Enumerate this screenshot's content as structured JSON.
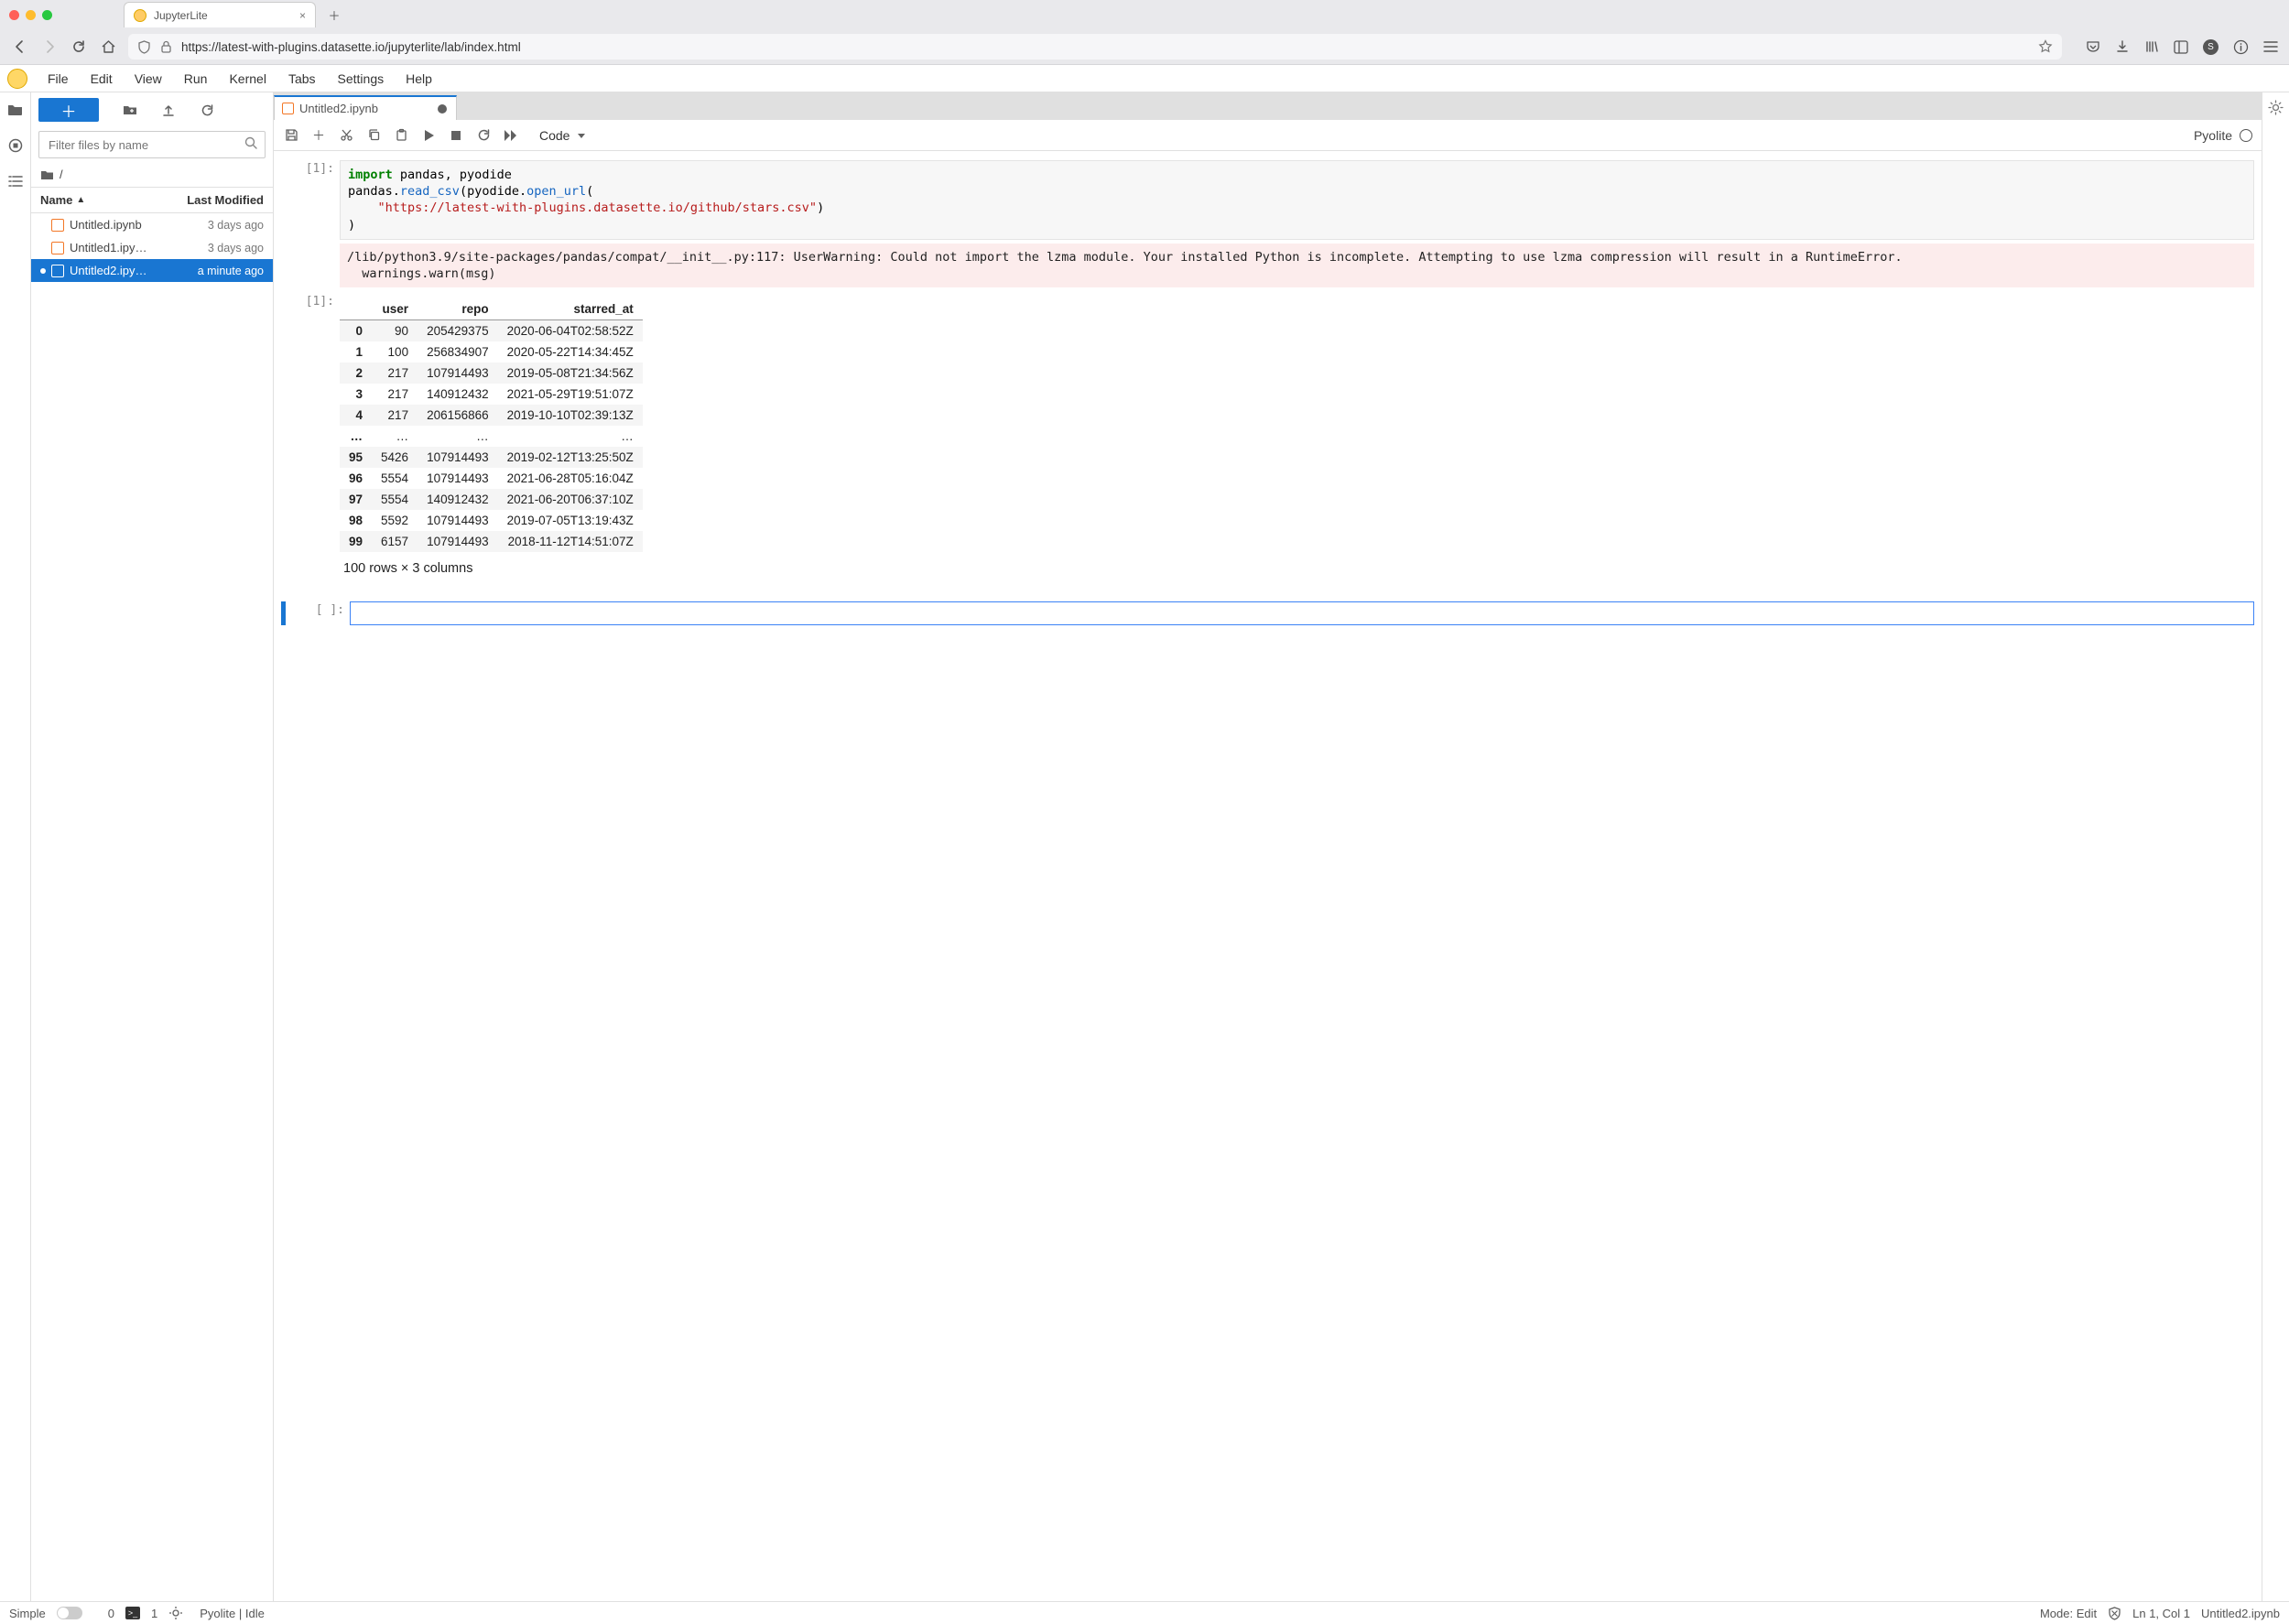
{
  "browser": {
    "tab_title": "JupyterLite",
    "url": "https://latest-with-plugins.datasette.io/jupyterlite/lab/index.html"
  },
  "menu": [
    "File",
    "Edit",
    "View",
    "Run",
    "Kernel",
    "Tabs",
    "Settings",
    "Help"
  ],
  "filebrowser": {
    "filter_placeholder": "Filter files by name",
    "crumb_root": "/",
    "head_name": "Name",
    "head_modified": "Last Modified",
    "files": [
      {
        "name": "Untitled.ipynb",
        "modified": "3 days ago",
        "dirty": false,
        "selected": false
      },
      {
        "name": "Untitled1.ipy…",
        "modified": "3 days ago",
        "dirty": false,
        "selected": false
      },
      {
        "name": "Untitled2.ipy…",
        "modified": "a minute ago",
        "dirty": true,
        "selected": true
      }
    ]
  },
  "work_tab": {
    "label": "Untitled2.ipynb"
  },
  "nb_toolbar": {
    "cell_type": "Code",
    "kernel_name": "Pyolite"
  },
  "cell1": {
    "prompt_in": "[1]:",
    "prompt_out": "[1]:",
    "code_kw": "import",
    "code_rest": " pandas, pyodide",
    "code_l2a": "pandas.",
    "code_l2b": "read_csv",
    "code_l2c": "(pyodide.",
    "code_l2d": "open_url",
    "code_l2e": "(",
    "code_url": "\"https://latest-with-plugins.datasette.io/github/stars.csv\"",
    "code_l3": ")",
    "code_l4": ")",
    "warning": "/lib/python3.9/site-packages/pandas/compat/__init__.py:117: UserWarning: Could not import the lzma module. Your installed Python is incomplete. Attempting to use lzma compression will result in a RuntimeError.\n  warnings.warn(msg)",
    "df": {
      "columns": [
        "",
        "user",
        "repo",
        "starred_at"
      ],
      "rows": [
        [
          "0",
          "90",
          "205429375",
          "2020-06-04T02:58:52Z"
        ],
        [
          "1",
          "100",
          "256834907",
          "2020-05-22T14:34:45Z"
        ],
        [
          "2",
          "217",
          "107914493",
          "2019-05-08T21:34:56Z"
        ],
        [
          "3",
          "217",
          "140912432",
          "2021-05-29T19:51:07Z"
        ],
        [
          "4",
          "217",
          "206156866",
          "2019-10-10T02:39:13Z"
        ],
        [
          "…",
          "…",
          "…",
          "…"
        ],
        [
          "95",
          "5426",
          "107914493",
          "2019-02-12T13:25:50Z"
        ],
        [
          "96",
          "5554",
          "107914493",
          "2021-06-28T05:16:04Z"
        ],
        [
          "97",
          "5554",
          "140912432",
          "2021-06-20T06:37:10Z"
        ],
        [
          "98",
          "5592",
          "107914493",
          "2019-07-05T13:19:43Z"
        ],
        [
          "99",
          "6157",
          "107914493",
          "2018-11-12T14:51:07Z"
        ]
      ],
      "summary": "100 rows × 3 columns"
    }
  },
  "empty_prompt": "[ ]:",
  "status": {
    "simple": "Simple",
    "zero": "0",
    "one": "1",
    "kernel": "Pyolite",
    "kernel_sep": "|",
    "kernel_state": "Idle",
    "mode": "Mode: Edit",
    "lncol": "Ln 1, Col 1",
    "filename": "Untitled2.ipynb"
  }
}
